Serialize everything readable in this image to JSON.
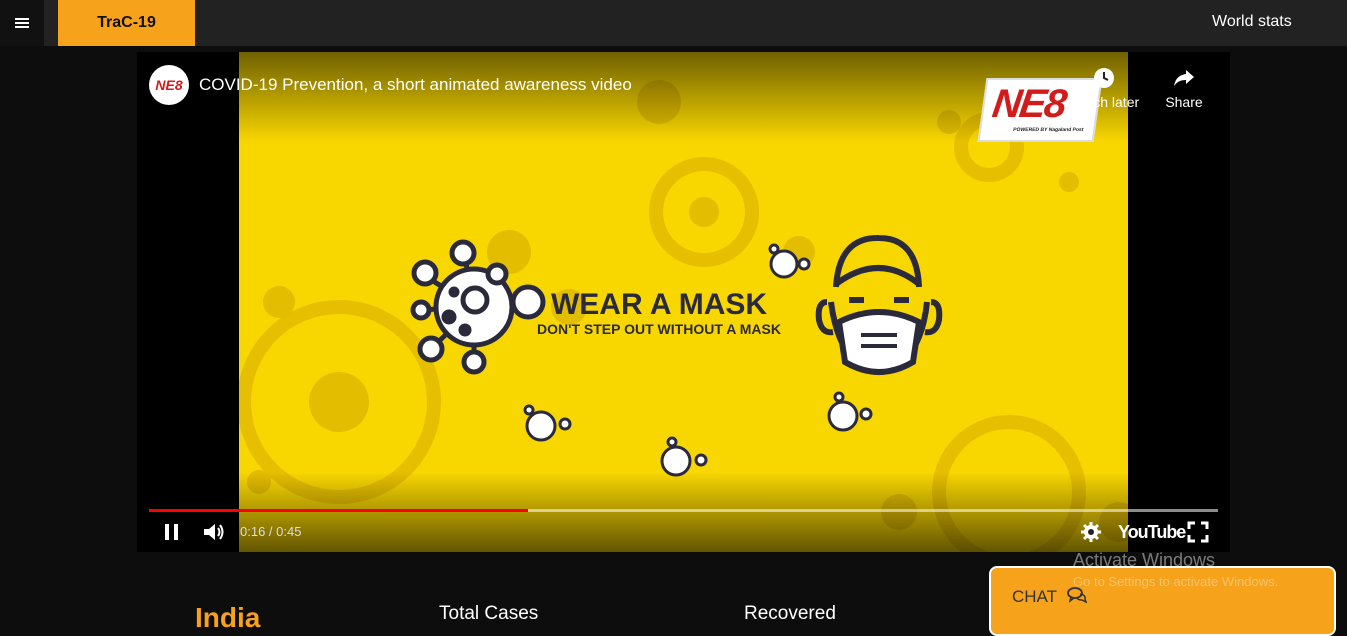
{
  "header": {
    "brand": "TraC-19",
    "world_stats": "World stats"
  },
  "video": {
    "channel_logo_text": "NE8",
    "title": "COVID-19 Prevention, a short animated awareness video",
    "watch_later": "Watch later",
    "share": "Share",
    "overlay_logo": {
      "big": "NE8",
      "small": "POWERED BY Nagaland Post"
    },
    "heading": "WEAR A MASK",
    "subheading": "DON'T STEP OUT WITHOUT A MASK",
    "current_time": "0:16",
    "duration": "0:45",
    "time_display": "0:16 / 0:45",
    "played_fraction": 0.355,
    "loaded_fraction": 0.355,
    "youtube_label": "YouTube",
    "colors": {
      "background": "#f8d600",
      "progress": "#ff0000"
    }
  },
  "os_watermark": {
    "title": "Activate Windows",
    "subtitle": "Go to Settings to activate Windows."
  },
  "stats": {
    "country": "India",
    "total_cases_label": "Total Cases",
    "recovered_label": "Recovered"
  },
  "chat": {
    "label": "CHAT"
  },
  "colors": {
    "accent": "#f7a21b",
    "topbar": "#222222",
    "page": "#0d0d0d"
  }
}
